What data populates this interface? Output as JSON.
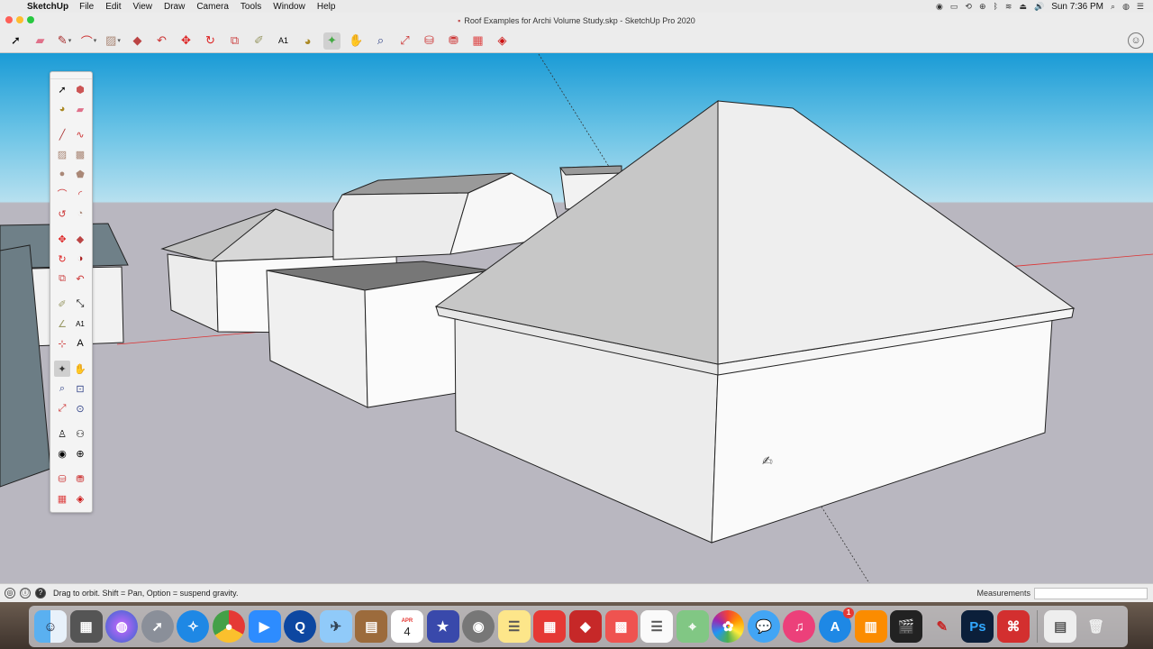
{
  "menubar": {
    "app_name": "SketchUp",
    "menus": [
      "File",
      "Edit",
      "View",
      "Draw",
      "Camera",
      "Tools",
      "Window",
      "Help"
    ],
    "clock": "Sun 7:36 PM"
  },
  "window": {
    "title": "Roof Examples for Archi Volume Study.skp - SketchUp Pro 2020"
  },
  "toolbar": {
    "tools": [
      "select-icon",
      "eraser-icon",
      "line-icon",
      "arc-icon",
      "rectangle-icon",
      "push-pull-icon",
      "offset-icon",
      "move-icon",
      "rotate-icon",
      "scale-icon",
      "tape-measure-icon",
      "text-icon",
      "paint-bucket-icon",
      "orbit-icon",
      "pan-icon",
      "zoom-icon",
      "zoom-extents-icon",
      "warehouse-icon",
      "extension-warehouse-icon",
      "layout-icon",
      "ruby-icon"
    ],
    "active_tool": "orbit-icon"
  },
  "tool_palette": {
    "active_tool": "orbit-icon"
  },
  "status": {
    "hint": "Drag to orbit. Shift = Pan, Option = suspend gravity.",
    "measurements_label": "Measurements",
    "measurements_value": ""
  },
  "dock": {
    "calendar_month": "APR",
    "calendar_day": "4",
    "app_store_badge": "1",
    "photoshop_label": "Ps"
  }
}
